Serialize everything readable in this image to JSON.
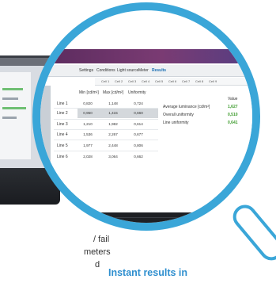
{
  "side_text": [
    "/ fail",
    "meters",
    "d"
  ],
  "caption": "Instant results in",
  "toolbar": {
    "tabs": [
      "Settings",
      "Conditions",
      "Light source",
      "Meter",
      "Results"
    ],
    "active_tab": "Results"
  },
  "cell_tabs": [
    "Cell 1",
    "Cell 2",
    "Cell 3",
    "Cell 4",
    "Cell 5",
    "Cell 6",
    "Cell 7",
    "Cell 8",
    "Cell 9"
  ],
  "grid": {
    "columns": [
      "Min [cd/m²]",
      "Max [cd/m²]",
      "Uniformity"
    ],
    "rows": [
      {
        "label": "Line 1",
        "min": "0,820",
        "max": "1,148",
        "uniformity": "0,724"
      },
      {
        "label": "Line 2",
        "min": "0,950",
        "max": "1,415",
        "uniformity": "0,660"
      },
      {
        "label": "Line 3",
        "min": "1,210",
        "max": "1,982",
        "uniformity": "0,614"
      },
      {
        "label": "Line 4",
        "min": "1,536",
        "max": "2,267",
        "uniformity": "0,677"
      },
      {
        "label": "Line 5",
        "min": "1,977",
        "max": "2,448",
        "uniformity": "0,806"
      },
      {
        "label": "Line 6",
        "min": "2,028",
        "max": "3,064",
        "uniformity": "0,662"
      }
    ],
    "selected_row": "Line 2"
  },
  "results": {
    "header": "Value",
    "items": [
      {
        "label": "Average luminance [cd/m²]",
        "value": "1,627"
      },
      {
        "label": "Overall uniformity",
        "value": "0,510"
      },
      {
        "label": "Line uniformity",
        "value": "0,641"
      }
    ]
  },
  "colors": {
    "accent": "#3aa6d8",
    "value_green": "#3d9b2d",
    "caption": "#2f8fcf"
  }
}
